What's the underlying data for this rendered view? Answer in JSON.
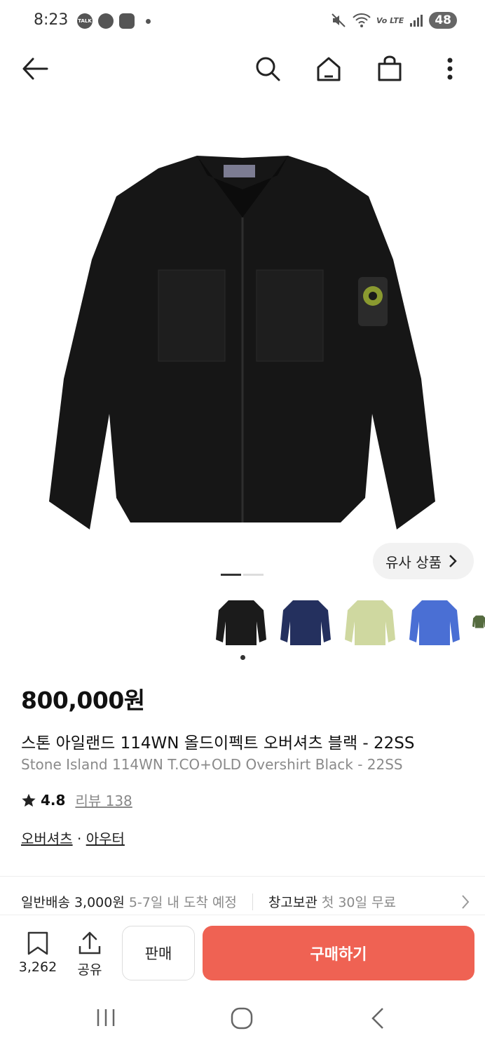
{
  "status": {
    "time": "8:23",
    "battery": "48",
    "network": "Vo LTE",
    "icons": [
      "talk-icon",
      "sports-icon",
      "game-icon",
      "dot-icon",
      "mute-icon",
      "wifi-icon",
      "volte-icon",
      "signal-icon",
      "battery-icon"
    ],
    "talk_label": "TALK"
  },
  "appbar": {
    "icons": [
      "back-arrow-icon",
      "search-icon",
      "home-icon",
      "shopping-bag-icon",
      "more-vert-icon"
    ]
  },
  "product": {
    "image_colors": {
      "body": "#161616",
      "patch": "#2b2b2b"
    },
    "similar_label": "유사 상품",
    "carousel": {
      "total": 2,
      "current": 1
    },
    "thumbnails": [
      {
        "color": "#1b1b1b",
        "selected": true
      },
      {
        "color": "#24305e",
        "selected": false
      },
      {
        "color": "#cfd8a0",
        "selected": false
      },
      {
        "color": "#4a6fd4",
        "selected": false
      },
      {
        "color": "#556b3f",
        "selected": false
      }
    ],
    "price": "800,000원",
    "name_ko": "스톤 아일랜드 114WN 올드이펙트 오버셔츠 블랙 - 22SS",
    "name_en": "Stone Island 114WN T.CO+OLD Overshirt Black - 22SS",
    "rating": "4.8",
    "reviews": "리뷰 138",
    "category_1": "오버셔츠",
    "category_sep": "·",
    "category_2": "아우터"
  },
  "delivery": {
    "shipping": "일반배송 3,000원",
    "eta": "5-7일 내 도착 예정",
    "storage": "창고보관",
    "storage_note": "첫 30일 무료"
  },
  "actions": {
    "wish_count": "3,262",
    "share_label": "공유",
    "sell_label": "판매",
    "buy_label": "구매하기",
    "buy_color": "#ef6253"
  },
  "navbar": {
    "icons": [
      "recent-apps-icon",
      "home-circle-icon",
      "back-chevron-icon"
    ]
  }
}
